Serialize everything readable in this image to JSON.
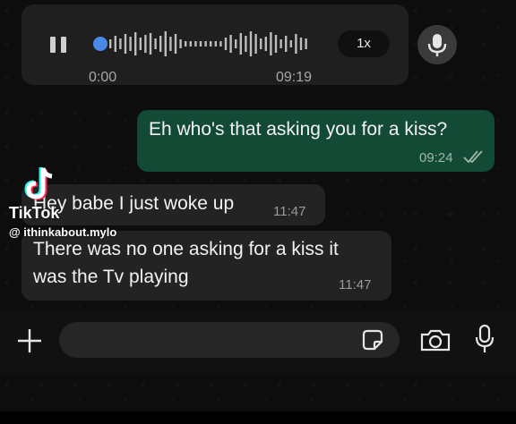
{
  "voice_note": {
    "current_time": "0:00",
    "duration": "09:19",
    "speed": "1x",
    "progress": 0
  },
  "messages": [
    {
      "direction": "out",
      "text": "Eh who's that asking you for a kiss?",
      "time": "09:24",
      "status": "read"
    },
    {
      "direction": "in",
      "text": "Hey babe I just woke up",
      "time": "11:47"
    },
    {
      "direction": "in",
      "lines": [
        "There was no one asking for a kiss it",
        "was the Tv playing"
      ],
      "time": "11:47"
    }
  ],
  "watermark": {
    "brand": "TikTok",
    "handle": "@ ithinkabout.mylo"
  },
  "composer": {
    "value": "",
    "placeholder": ""
  },
  "icons": [
    "pause-icon",
    "microphone-icon",
    "plus-icon",
    "sticker-icon",
    "camera-icon",
    "double-check-icon",
    "tiktok-logo-icon"
  ],
  "colors": {
    "outgoing_bubble": "#124a36",
    "incoming_bubble": "#232323",
    "progress_accent": "#4a8ae6",
    "background": "#0d0d0d"
  }
}
